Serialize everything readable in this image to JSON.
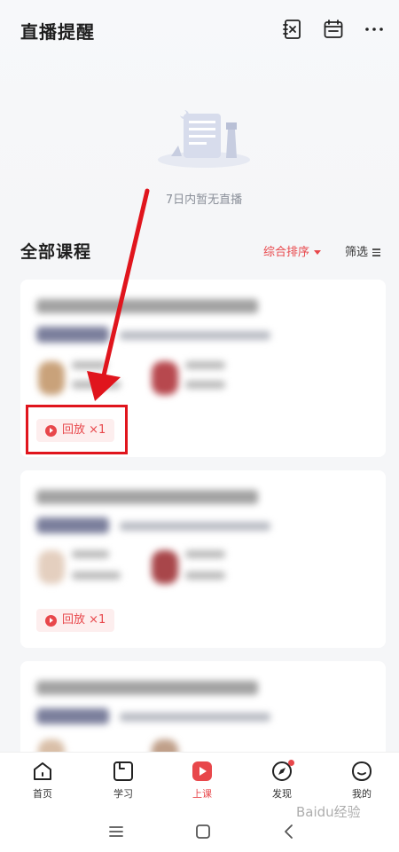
{
  "header": {
    "title": "直播提醒"
  },
  "empty_state": {
    "text": "7日内暂无直播"
  },
  "courses": {
    "section_title": "全部课程",
    "sort_label": "综合排序",
    "filter_label": "筛选",
    "replay_label": "回放 ×1"
  },
  "tabbar": {
    "items": [
      {
        "label": "首页",
        "icon": "home-icon"
      },
      {
        "label": "学习",
        "icon": "study-icon"
      },
      {
        "label": "上课",
        "icon": "class-icon"
      },
      {
        "label": "发现",
        "icon": "compass-icon"
      },
      {
        "label": "我的",
        "icon": "profile-icon"
      }
    ]
  },
  "watermark": {
    "text": "Baidu经验"
  },
  "colors": {
    "accent": "#e8474b",
    "annotation": "#e0151d"
  }
}
